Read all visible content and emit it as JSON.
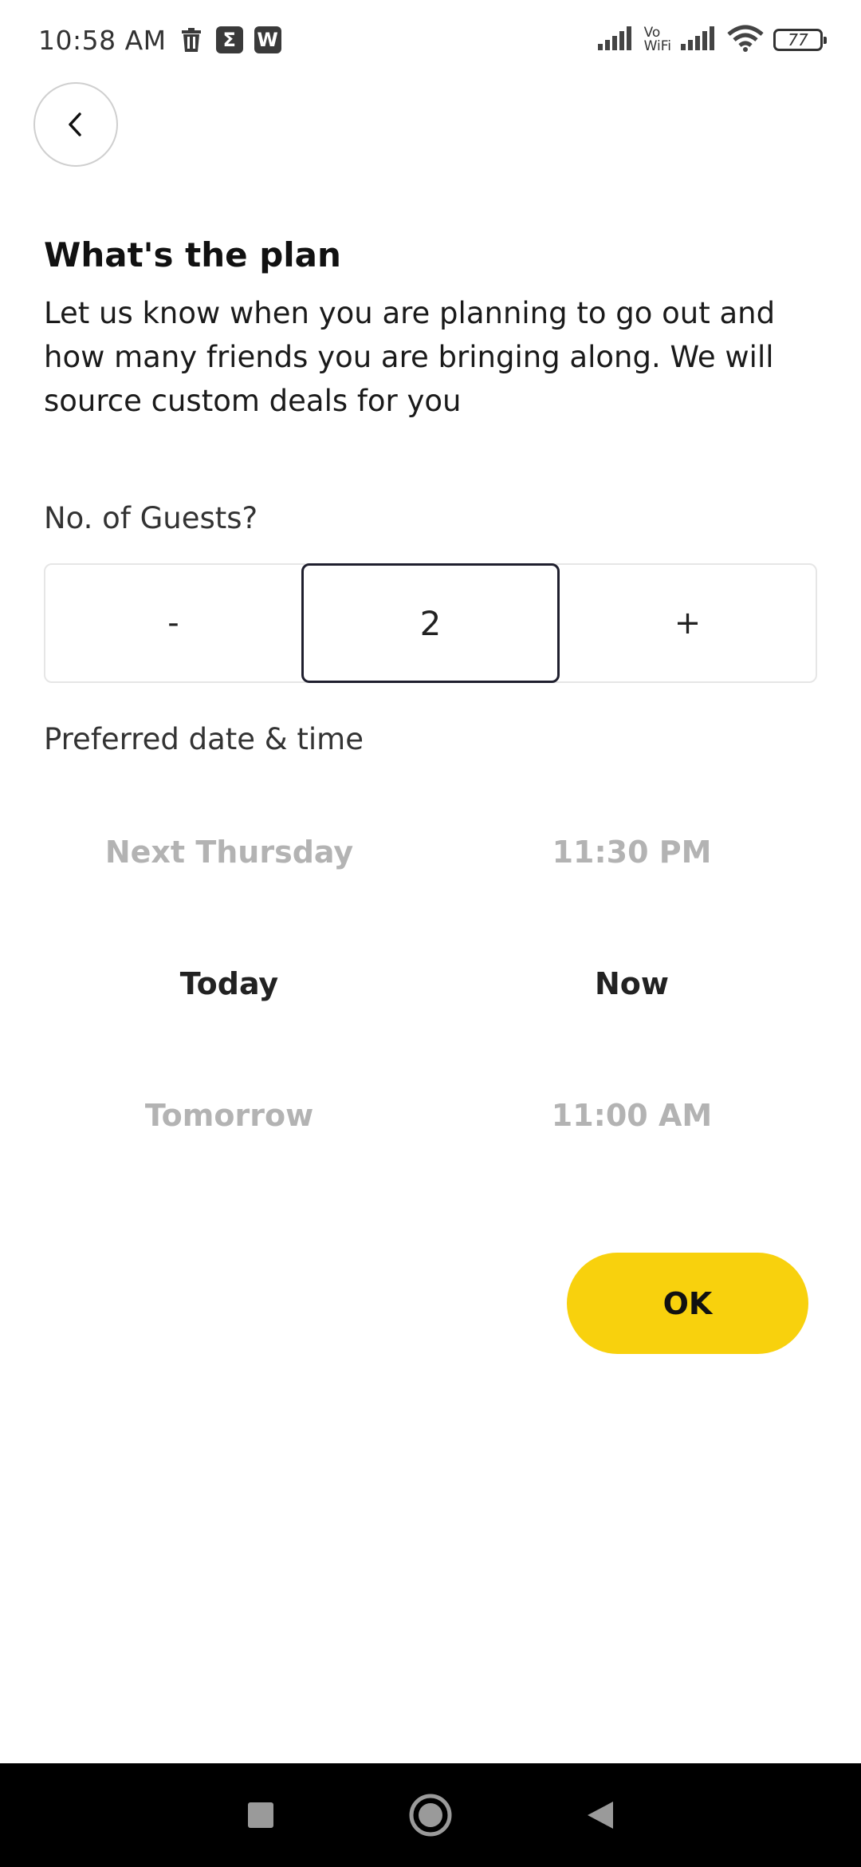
{
  "status_bar": {
    "time": "10:58 AM",
    "vo_label": "Vo",
    "wifi_label": "WiFi",
    "battery": "77"
  },
  "page": {
    "title": "What's the plan",
    "subtitle": "Let us know when you are planning to go out and how many friends you are bringing along. We will source custom deals for you"
  },
  "guests": {
    "label": "No. of Guests?",
    "minus": "-",
    "value": "2",
    "plus": "+"
  },
  "schedule": {
    "label": "Preferred date & time",
    "dates": [
      "Next Thursday",
      "Today",
      "Tomorrow"
    ],
    "times": [
      "11:30 PM",
      "Now",
      "11:00 AM"
    ]
  },
  "ok_label": "OK",
  "colors": {
    "accent": "#f8d10d",
    "selected_text": "#222222",
    "unselected_text": "#b3b3b3"
  }
}
